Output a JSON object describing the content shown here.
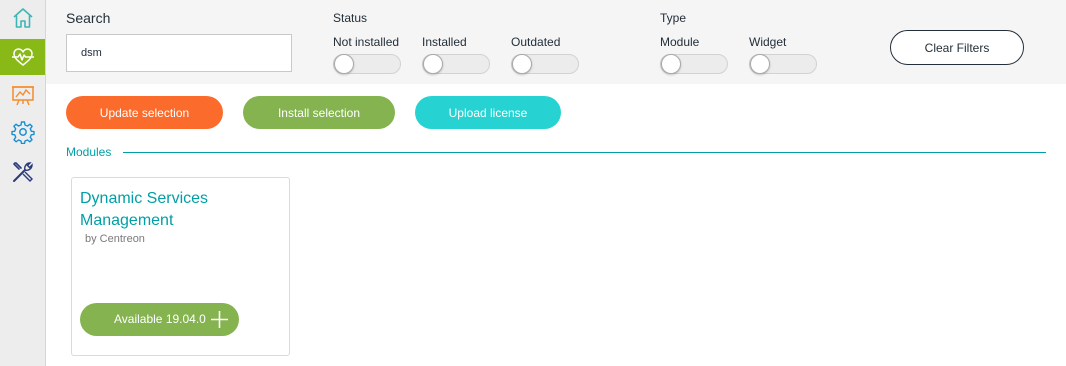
{
  "sidebar": {
    "items": [
      {
        "name": "home",
        "icon": "home-icon",
        "color": "#3cb7b4"
      },
      {
        "name": "monitoring",
        "icon": "heartbeat-icon",
        "color": "#ffffff",
        "active": true
      },
      {
        "name": "reporting",
        "icon": "presentation-chart-icon",
        "color": "#f58b2b"
      },
      {
        "name": "configuration",
        "icon": "gear-icon",
        "color": "#1b90d0"
      },
      {
        "name": "administration",
        "icon": "tools-icon",
        "color": "#2b3a7a"
      }
    ],
    "active_color": "#88b917"
  },
  "filters": {
    "search_label": "Search",
    "search_value": "dsm",
    "status_label": "Status",
    "status_options": [
      {
        "label": "Not installed",
        "on": false
      },
      {
        "label": "Installed",
        "on": false
      },
      {
        "label": "Outdated",
        "on": false
      }
    ],
    "type_label": "Type",
    "type_options": [
      {
        "label": "Module",
        "on": false
      },
      {
        "label": "Widget",
        "on": false
      }
    ],
    "clear_label": "Clear Filters"
  },
  "actions": {
    "update_label": "Update selection",
    "install_label": "Install selection",
    "upload_label": "Upload license",
    "colors": {
      "update": "#fa6b2c",
      "install": "#84b34f",
      "upload": "#26d3d2"
    }
  },
  "modules_section": {
    "title": "Modules",
    "cards": [
      {
        "title": "Dynamic Services Management",
        "author": "by Centreon",
        "button_label": "Available 19.04.0",
        "button_icon": "plus-icon"
      }
    ]
  }
}
